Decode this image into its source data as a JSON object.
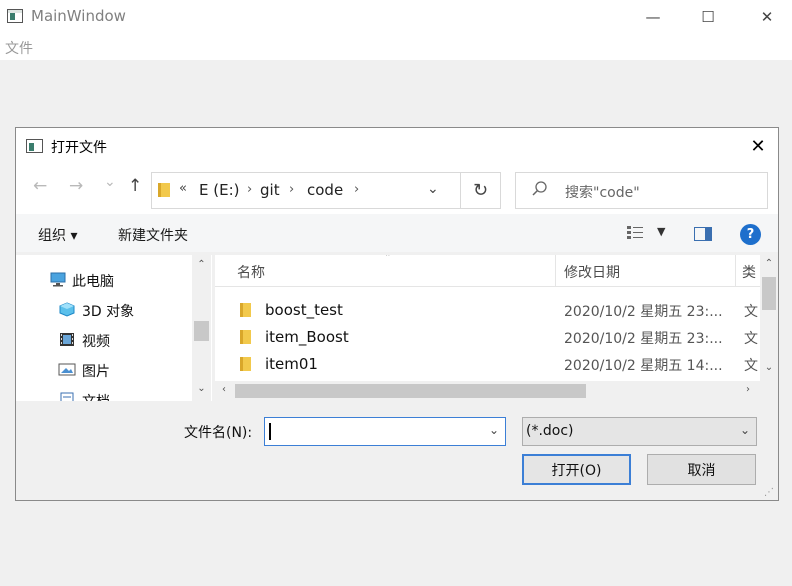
{
  "window": {
    "title": "MainWindow",
    "controls": {
      "minimize": "—",
      "maximize": "☐",
      "close": "✕"
    }
  },
  "menu": {
    "file": "文件"
  },
  "dialog": {
    "title": "打开文件",
    "close": "✕",
    "nav": {
      "back": "←",
      "forward": "→",
      "recent": "⌄",
      "up": "↑"
    },
    "address": {
      "more": "«",
      "crumbs": [
        "E (E:)",
        "git",
        "code"
      ],
      "separator": "›",
      "dropdown": "⌄",
      "refresh": "↻"
    },
    "search": {
      "placeholder": "搜索\"code\""
    },
    "toolbar": {
      "organize": "组织 ▾",
      "new_folder": "新建文件夹",
      "view_dropdown": "▼",
      "help": "?"
    },
    "nav_pane": {
      "items": [
        {
          "label": "此电脑",
          "icon": "computer-icon"
        },
        {
          "label": "3D 对象",
          "icon": "3d-objects-icon"
        },
        {
          "label": "视频",
          "icon": "video-icon"
        },
        {
          "label": "图片",
          "icon": "pictures-icon"
        },
        {
          "label": "文档",
          "icon": "documents-icon"
        }
      ]
    },
    "file_list": {
      "columns": {
        "name": "名称",
        "date": "修改日期",
        "type": "类"
      },
      "rows": [
        {
          "name": "boost_test",
          "date": "2020/10/2 星期五 23:...",
          "type": "文"
        },
        {
          "name": "item_Boost",
          "date": "2020/10/2 星期五 23:...",
          "type": "文"
        },
        {
          "name": "item01",
          "date": "2020/10/2 星期五 14:...",
          "type": "文"
        }
      ]
    },
    "filename": {
      "label": "文件名(N):",
      "value": ""
    },
    "filter": {
      "selected": "(*.doc)"
    },
    "buttons": {
      "open": "打开(O)",
      "cancel": "取消"
    }
  }
}
